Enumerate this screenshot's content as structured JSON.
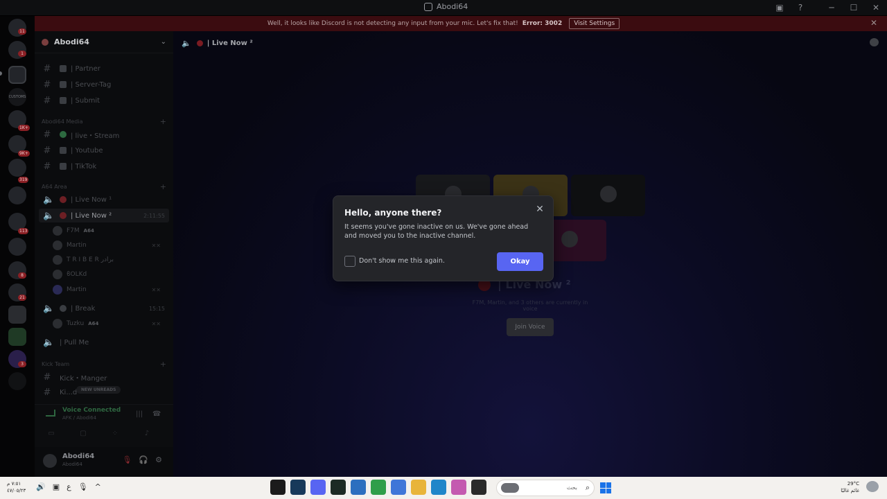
{
  "titlebar": {
    "title": "Abodi64",
    "minimize": "─",
    "maximize": "☐",
    "close": "✕",
    "inbox": "▣",
    "help": "?"
  },
  "banner": {
    "message": "Well, it looks like Discord is not detecting any input from your mic. Let's fix that!",
    "error": "Error: 3002",
    "action": "Visit Settings",
    "close": "✕"
  },
  "rail": {
    "badges": [
      "11",
      "1",
      "1K+",
      "9K+",
      "319",
      "113",
      "8",
      "21",
      "3"
    ],
    "customs_label": "CUSTOMS"
  },
  "guild": {
    "name": "Abodi64",
    "chevron": "⌄"
  },
  "channels": {
    "partner": "| Partner",
    "server_tag": "| Server-Tag",
    "submit": "| Submit",
    "cat_media": "Abodi64 Media",
    "live_stream": "| live・Stream",
    "youtube": "| Youtube",
    "tiktok": "| TikTok",
    "cat_area": "A64 Area",
    "live_now_1": "| Live Now ¹",
    "live_now_2": "| Live Now ²",
    "live_now_2_time": "2:11:55",
    "break": "| Break",
    "break_time": "15:15",
    "pull_me": "| Pull Me",
    "cat_kick": "Kick Team",
    "kick_manger": "Kick・Manger",
    "kick_partial": "Ki...d"
  },
  "voice_users": {
    "u1": "F7M",
    "u1_tag": "A64",
    "u2": "Martin",
    "u3": "T R I B E R برادر",
    "u4": "ϐOLKd",
    "u5": "Martin",
    "break_user": "Tuzku",
    "break_user_tag": "A64"
  },
  "new_unreads": "NEW UNREADS",
  "voice_panel": {
    "status": "Voice Connected",
    "location": "AFK / Abodi64"
  },
  "user_panel": {
    "username": "Abodi64",
    "status": "Abodi64"
  },
  "main": {
    "channel_name": "| Live Now ²",
    "lobby_title": "| Live Now ²",
    "lobby_subtitle": "F7M, Martin, and 3 others are currently in voice",
    "join_button": "Join Voice"
  },
  "modal": {
    "title": "Hello, anyone there?",
    "body": "It seems you've gone inactive on us. We've gone ahead and moved you to the inactive channel.",
    "checkbox_label": "Don't show me this again.",
    "ok_button": "Okay",
    "close": "✕",
    "accent": "#5865f2"
  },
  "taskbar": {
    "time": "٧:٥١ م",
    "date": "٤٧/٠٥/٢٣",
    "lang": "ع",
    "search_placeholder": "بحث",
    "weather_temp": "29°C",
    "weather_desc": "غائم غالبًا"
  }
}
